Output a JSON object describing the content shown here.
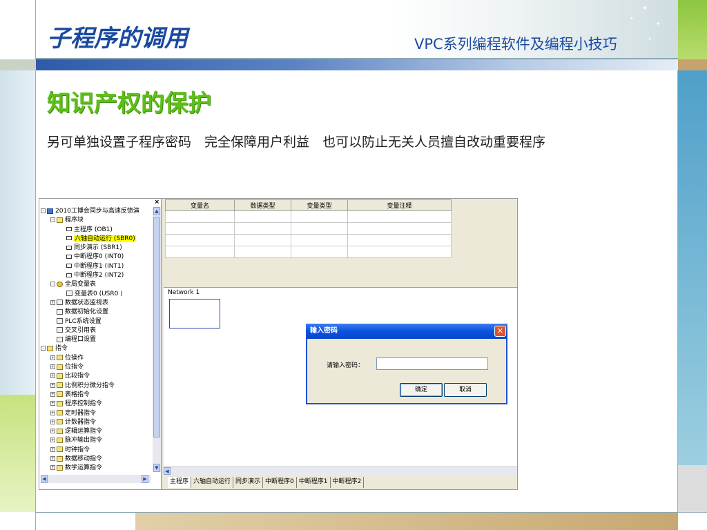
{
  "slide": {
    "title": "子程序的调用",
    "subtitle": "VPC系列编程软件及编程小技巧",
    "heading": "知识产权的保护",
    "body": "另可单独设置子程序密码　完全保障用户利益　也可以防止无关人员擅自改动重要程序"
  },
  "software": {
    "tree_close": "×",
    "tree": [
      {
        "indent": 0,
        "box": "-",
        "icon": "root",
        "label": "2010工博会同步与高速反馈演"
      },
      {
        "indent": 1,
        "box": "-",
        "icon": "folder",
        "label": "程序块"
      },
      {
        "indent": 2,
        "box": "",
        "icon": "prog",
        "label": "主程序 (OB1)"
      },
      {
        "indent": 2,
        "box": "",
        "icon": "prog",
        "label": "六轴自动运行 (SBR0)",
        "selected": true
      },
      {
        "indent": 2,
        "box": "",
        "icon": "prog",
        "label": "同步演示 (SBR1)"
      },
      {
        "indent": 2,
        "box": "",
        "icon": "prog",
        "label": "中断程序0 (INT0)"
      },
      {
        "indent": 2,
        "box": "",
        "icon": "prog",
        "label": "中断程序1 (INT1)"
      },
      {
        "indent": 2,
        "box": "",
        "icon": "prog",
        "label": "中断程序2 (INT2)"
      },
      {
        "indent": 1,
        "box": "-",
        "icon": "sym",
        "label": "全局变量表"
      },
      {
        "indent": 2,
        "box": "",
        "icon": "doc",
        "label": "变量表0 (USR0 )"
      },
      {
        "indent": 1,
        "box": "+",
        "icon": "doc",
        "label": "数据状态监视表"
      },
      {
        "indent": 1,
        "box": "",
        "icon": "doc",
        "label": "数据初始化设置"
      },
      {
        "indent": 1,
        "box": "",
        "icon": "doc",
        "label": "PLC系统设置"
      },
      {
        "indent": 1,
        "box": "",
        "icon": "doc",
        "label": "交叉引用表"
      },
      {
        "indent": 1,
        "box": "",
        "icon": "doc",
        "label": "编程口设置"
      },
      {
        "indent": 0,
        "box": "-",
        "icon": "folder",
        "label": "指令"
      },
      {
        "indent": 1,
        "box": "+",
        "icon": "folder",
        "label": "位操作"
      },
      {
        "indent": 1,
        "box": "+",
        "icon": "folder",
        "label": "位指令"
      },
      {
        "indent": 1,
        "box": "+",
        "icon": "folder",
        "label": "比较指令"
      },
      {
        "indent": 1,
        "box": "+",
        "icon": "folder",
        "label": "比例积分微分指令"
      },
      {
        "indent": 1,
        "box": "+",
        "icon": "folder",
        "label": "表格指令"
      },
      {
        "indent": 1,
        "box": "+",
        "icon": "folder",
        "label": "程序控制指令"
      },
      {
        "indent": 1,
        "box": "+",
        "icon": "folder",
        "label": "定时器指令"
      },
      {
        "indent": 1,
        "box": "+",
        "icon": "folder",
        "label": "计数器指令"
      },
      {
        "indent": 1,
        "box": "+",
        "icon": "folder",
        "label": "逻辑运算指令"
      },
      {
        "indent": 1,
        "box": "+",
        "icon": "folder",
        "label": "脉冲输出指令"
      },
      {
        "indent": 1,
        "box": "+",
        "icon": "folder",
        "label": "时钟指令"
      },
      {
        "indent": 1,
        "box": "+",
        "icon": "folder",
        "label": "数据移动指令"
      },
      {
        "indent": 1,
        "box": "+",
        "icon": "folder",
        "label": "数学运算指令"
      }
    ],
    "var_table": {
      "columns": [
        "变量名",
        "数据类型",
        "变量类型",
        "变量注释"
      ],
      "empty_rows": 4
    },
    "network_label": "Network 1",
    "tabs": [
      "主程序",
      "六轴自动运行",
      "同步演示",
      "中断程序0",
      "中断程序1",
      "中断程序2"
    ],
    "active_tab": 0,
    "scroll_glyphs": {
      "up": "▲",
      "down": "▼",
      "left": "◀",
      "right": "▶"
    }
  },
  "dialog": {
    "title": "输入密码",
    "close": "✕",
    "label": "请输入密码：",
    "value": "",
    "ok": "确定",
    "cancel": "取消"
  },
  "colors": {
    "title": "#1a4aa0",
    "heading": "#5fbf1a",
    "dialog_title": "#0a53e0"
  }
}
